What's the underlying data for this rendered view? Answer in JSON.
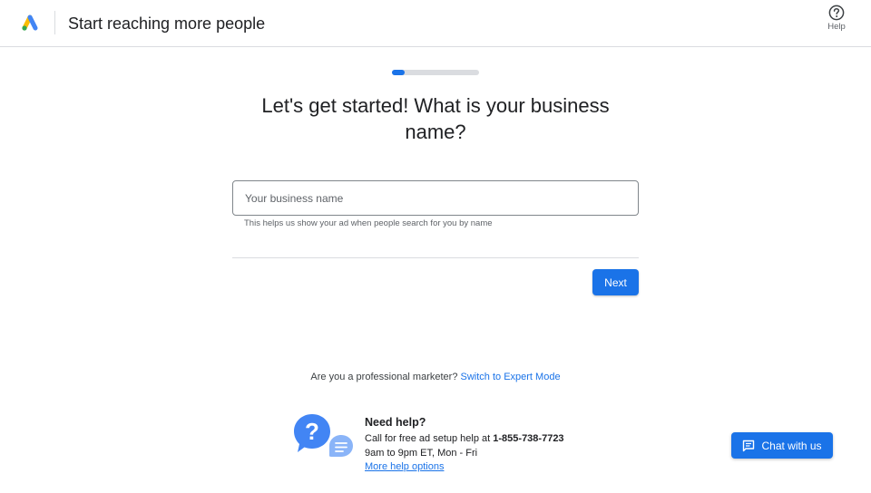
{
  "header": {
    "title": "Start reaching more people",
    "help_label": "Help"
  },
  "progress": {
    "fraction": 0.15
  },
  "main": {
    "question": "Let's get started! What is your business name?",
    "input_placeholder": "Your business name",
    "input_value": "",
    "helper_text": "This helps us show your ad when people search for you by name",
    "next_label": "Next"
  },
  "expert": {
    "prompt": "Are you a professional marketer?",
    "link": "Switch to Expert Mode"
  },
  "help": {
    "title": "Need help?",
    "call_text": "Call for free ad setup help at",
    "phone": "1-855-738-7723",
    "hours": "9am to 9pm ET, Mon - Fri",
    "more_link": "More help options"
  },
  "chat": {
    "label": "Chat with us"
  },
  "colors": {
    "accent": "#1a73e8",
    "logo_blue": "#4285f4",
    "logo_yellow": "#fbbc04",
    "logo_green": "#34a853"
  },
  "icons": {
    "logo": "google-ads-logo",
    "help": "question-circle-icon",
    "chat": "chat-bubble-icon",
    "help_illustration": "question-bubble-icon"
  }
}
